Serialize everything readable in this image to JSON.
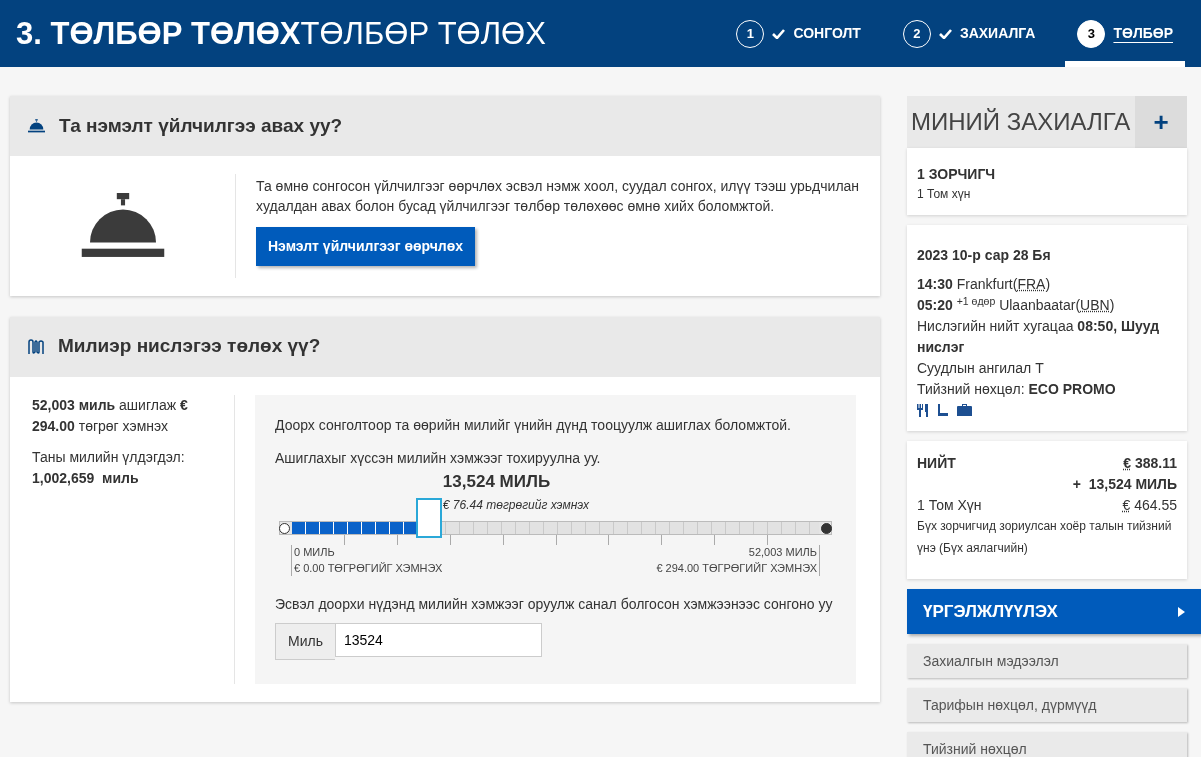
{
  "header": {
    "title_bold": "3. ТӨЛБӨР ТӨЛӨХ",
    "title_light": "ТӨЛБӨР ТӨЛӨХ",
    "steps": [
      {
        "number": "1",
        "label": "СОНГОЛТ",
        "completed": true,
        "selected": false
      },
      {
        "number": "2",
        "label": "ЗАХИАЛГА",
        "completed": true,
        "selected": false
      },
      {
        "number": "3",
        "label": "ТӨЛБӨР",
        "completed": false,
        "selected": true
      }
    ]
  },
  "services": {
    "title": "Та нэмэлт үйлчилгээ авах уу?",
    "description": "Та өмнө сонгосон үйлчилгээг өөрчлөх эсвэл нэмж хоол, суудал сонгох, илүү тээш урьдчилан худалдан авах болон бусад үйлчилгээг төлбөр төлөхөөс өмнө хийх боломжтой.",
    "button": "Нэмэлт үйлчилгээг өөрчлөх"
  },
  "miles": {
    "title": "Милиэр нислэгээ төлөх үү?",
    "summary": "**52,003 миль** ашиглаж **€ 294.00** төгрөг хэмнэх",
    "balance_label": "Таны милийн үлдэгдэл:",
    "balance_value": "1,002,659  миль",
    "intro": "Доорх сонголтоор та өөрийн милийг үнийн дүнд тооцуулж ашиглах боломжтой.",
    "instruction": "Ашиглахыг хүссэн милийн хэмжээг тохируулна уу.",
    "slider": {
      "level": 0.26,
      "value_label": "13,524 МИЛЬ",
      "savings_label": "€ 76.44 төгрөгийг хэмнэх",
      "min_label": "0 МИЛЬ",
      "min_savings": "€ 0.00 ТӨГРӨГИЙГ ХЭМНЭХ",
      "max_label": "52,003 МИЛЬ",
      "max_savings": "€ 294.00 ТӨГРӨГИЙГ ХЭМНЭХ"
    },
    "manual_prompt": "Эсвэл доорхи нүдэнд милийн хэмжээг оруулж санал болгосон хэмжээнээс сонгоно уу",
    "input": {
      "addon": "Миль",
      "value": "13524"
    }
  },
  "sidebar": {
    "title": "МИНИЙ ЗАХИАЛГА",
    "add_button": "+",
    "passengers": {
      "title": "1 ЗОРЧИГЧ",
      "subtitle": "1 Том хүн"
    },
    "flight": {
      "date": "2023 10-р сар 28 Бя",
      "departure": {
        "time": "14:30",
        "city": "Frankfurt(",
        "code": "FRA",
        "close": ")"
      },
      "arrival": {
        "time": "05:20",
        "day_offset": "+1 өдөр",
        "city": "Ulaanbaatar(",
        "code": "UBN",
        "close": ")"
      },
      "duration": "Нислэгийн нийт хугацаа **08:50, Шууд нислэг**",
      "cabin": "Суудлын ангилал T",
      "fare": "Тийзний нөхцөл: **ECO PROMO**"
    },
    "total": {
      "label": "НИЙТ",
      "currency": "€",
      "price": "388.11",
      "miles": "+  13,524 МИЛЬ",
      "passenger": "1 Том Хүн",
      "passenger_currency": "€",
      "passenger_price": "464.55",
      "note": "Бүх зорчигчид зориулсан хоёр талын тийзний үнэ (Бүх аялагчийн)"
    },
    "continue_button": "ҮРГЭЛЖЛҮҮЛЭХ",
    "links": [
      "Захиалгын мэдээлэл",
      "Тарифын нөхцөл, дүрмүүд",
      "Тийзний нөхцөл"
    ]
  }
}
